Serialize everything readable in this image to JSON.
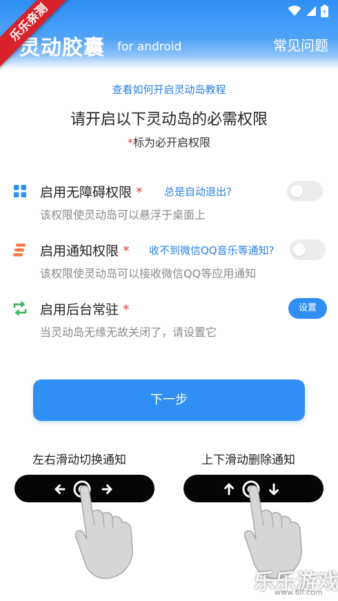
{
  "header": {
    "title": "灵动胶囊",
    "subtitle": "for android",
    "faq_label": "常见问题",
    "ribbon_text": "乐乐亲测"
  },
  "tutorial_link": "查看如何开启灵动岛教程",
  "heading": "请开启以下灵动岛的必需权限",
  "required_note": {
    "star": "*",
    "text": "标为必开启权限"
  },
  "permissions": [
    {
      "title": "启用无障碍权限",
      "star": "*",
      "help": "总是自动退出?",
      "desc": "该权限使灵动岛可以悬浮于桌面上",
      "icon": "grid-icon",
      "control": "toggle",
      "enabled": false
    },
    {
      "title": "启用通知权限",
      "star": "*",
      "help": "收不到微信QQ音乐等通知?",
      "desc": "该权限使灵动岛可以接收微信QQ等应用通知",
      "icon": "notification-stack-icon",
      "control": "toggle",
      "enabled": false
    },
    {
      "title": "启用后台常驻",
      "star": "*",
      "help": "",
      "desc": "当灵动岛无缘无故关闭了，请设置它",
      "icon": "background-sync-icon",
      "control": "button",
      "button_label": "设置"
    }
  ],
  "next_button": "下一步",
  "gesture_demos": [
    {
      "label": "左右滑动切换通知",
      "icons": [
        "arrow-left-icon",
        "touch-circle-icon",
        "arrow-right-icon"
      ]
    },
    {
      "label": "上下滑动删除通知",
      "icons": [
        "arrow-up-icon",
        "touch-circle-icon",
        "arrow-down-icon"
      ]
    }
  ],
  "watermark": {
    "text": "乐乐游戏",
    "url": "www.6ll.com"
  },
  "colors": {
    "primary": "#2f8ff5",
    "link": "#2a7fe6",
    "required_star": "#e63a3a",
    "icon_blue": "#2f8ff5",
    "icon_orange": "#f47a45",
    "icon_green": "#2fb35a",
    "ribbon": "#d8222b"
  }
}
